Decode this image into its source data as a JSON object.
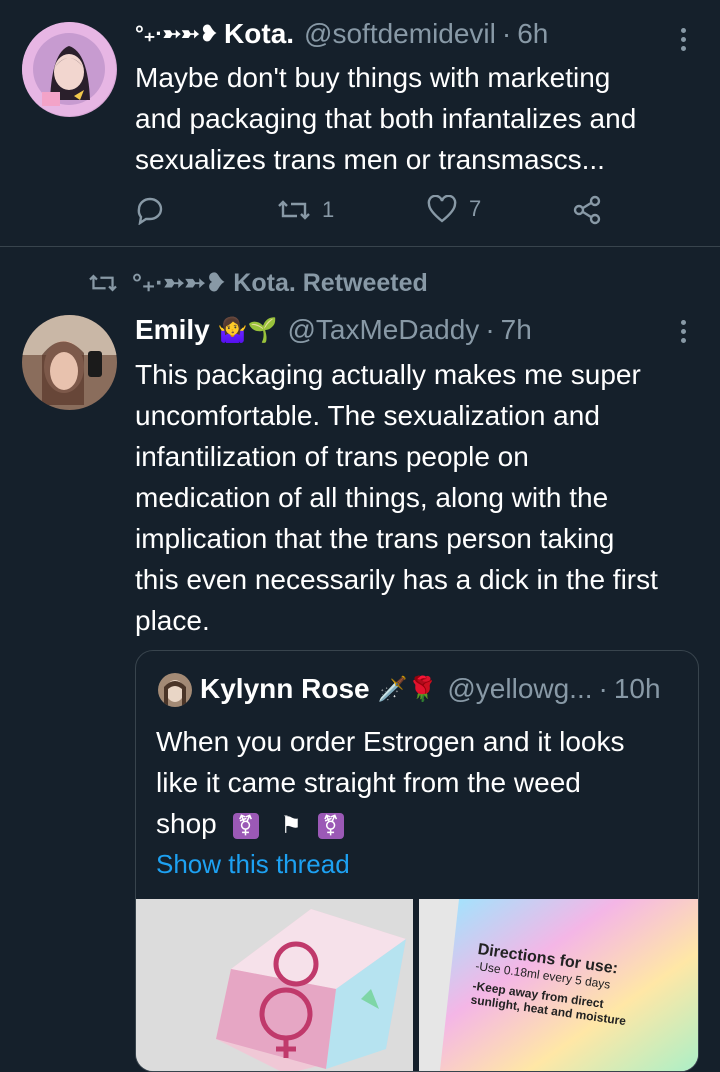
{
  "tweet1": {
    "display_name": "Kota.",
    "name_prefix": "°₊·➳➳❥",
    "handle": "@softdemidevil",
    "time": "6h",
    "text_lines": [
      "Maybe don't buy things with marketing",
      "and packaging that both infantalizes and",
      "sexualizes trans men or transmascs..."
    ],
    "retweet_count": "1",
    "like_count": "7",
    "icons": [
      "avatar-anime",
      "more-icon",
      "reply-icon",
      "retweet-icon",
      "like-icon",
      "share-icon"
    ]
  },
  "retweet_context": {
    "text": "°₊·➳➳❥ Kota. Retweeted"
  },
  "tweet2": {
    "display_name": "Emily",
    "name_emoji": "🤷‍♀️🌱",
    "handle": "@TaxMeDaddy",
    "time": "7h",
    "text_lines": [
      "This packaging actually makes me super",
      "uncomfortable. The sexualization and",
      "infantilization of trans people on",
      "medication of all things, along with the",
      "implication that the trans person taking",
      "this even necessarily has a dick in the first",
      "place."
    ]
  },
  "quote": {
    "display_name": "Kylynn Rose",
    "name_emoji": "🗡️🌹",
    "handle": "@yellowg...",
    "time": "10h",
    "text_lines": [
      "When you order Estrogen and it looks",
      "like it came straight from the weed",
      "shop"
    ],
    "emoji_trail": [
      "⚧",
      "⚑",
      "⚧"
    ],
    "show_thread": "Show this thread",
    "image_right_text": [
      "Directions for use:",
      "-Use 0.18ml every 5 days",
      "-Keep away from direct",
      "sunlight, heat and moisture"
    ]
  },
  "colors": {
    "background": "#15202b",
    "muted": "#8899a6",
    "link": "#1da1f2",
    "divider": "#38444d"
  }
}
